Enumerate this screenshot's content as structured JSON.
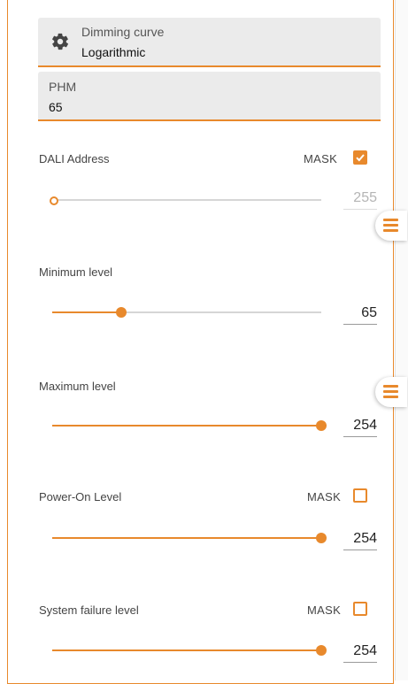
{
  "dimming_curve": {
    "label": "Dimming curve",
    "value": "Logarithmic",
    "icon": "gear-icon"
  },
  "phm": {
    "label": "PHM",
    "value": "65"
  },
  "dali_address": {
    "label": "DALI Address",
    "mask_label": "MASK",
    "mask_checked": true,
    "value": "255",
    "slider_fraction": 0.0,
    "disabled": true
  },
  "minimum_level": {
    "label": "Minimum level",
    "value": "65",
    "slider_fraction": 0.25
  },
  "maximum_level": {
    "label": "Maximum level",
    "value": "254",
    "slider_fraction": 1.0
  },
  "power_on_level": {
    "label": "Power-On Level",
    "mask_label": "MASK",
    "mask_checked": false,
    "value": "254",
    "slider_fraction": 1.0
  },
  "system_failure_level": {
    "label": "System failure level",
    "mask_label": "MASK",
    "mask_checked": false,
    "value": "254",
    "slider_fraction": 1.0
  },
  "colors": {
    "accent": "#e8892c",
    "field_bg": "#ebebeb",
    "track": "#d6d6d6"
  },
  "icons": {
    "side_menu": "menu-icon"
  }
}
